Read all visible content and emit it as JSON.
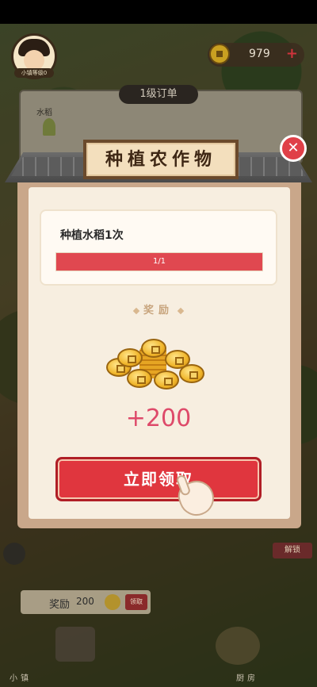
{
  "hud": {
    "level_text": "小镇等级0",
    "coins": "979",
    "coins_plus": "+"
  },
  "order": {
    "tab_label": "1级订单",
    "crop_name": "水稻"
  },
  "modal": {
    "title": "种植农作物",
    "close_symbol": "✕",
    "task_title": "种植水稻1次",
    "progress_text": "1/1",
    "progress": 1.0,
    "reward_label": "奖励",
    "reward_amount": "+200",
    "claim_label": "立即领取"
  },
  "bottom": {
    "reward_label": "奖励",
    "reward_amount": "200",
    "reward_button": "领取",
    "lock_label": "解锁",
    "nav_left": "小镇",
    "nav_right": "厨房"
  },
  "colors": {
    "accent_red": "#e0363e",
    "reward_pink": "#de4a6a",
    "gold": "#f0b52a"
  },
  "icons": {
    "coin": "coin-icon",
    "close": "close-icon",
    "hand": "tap-hand-icon"
  }
}
